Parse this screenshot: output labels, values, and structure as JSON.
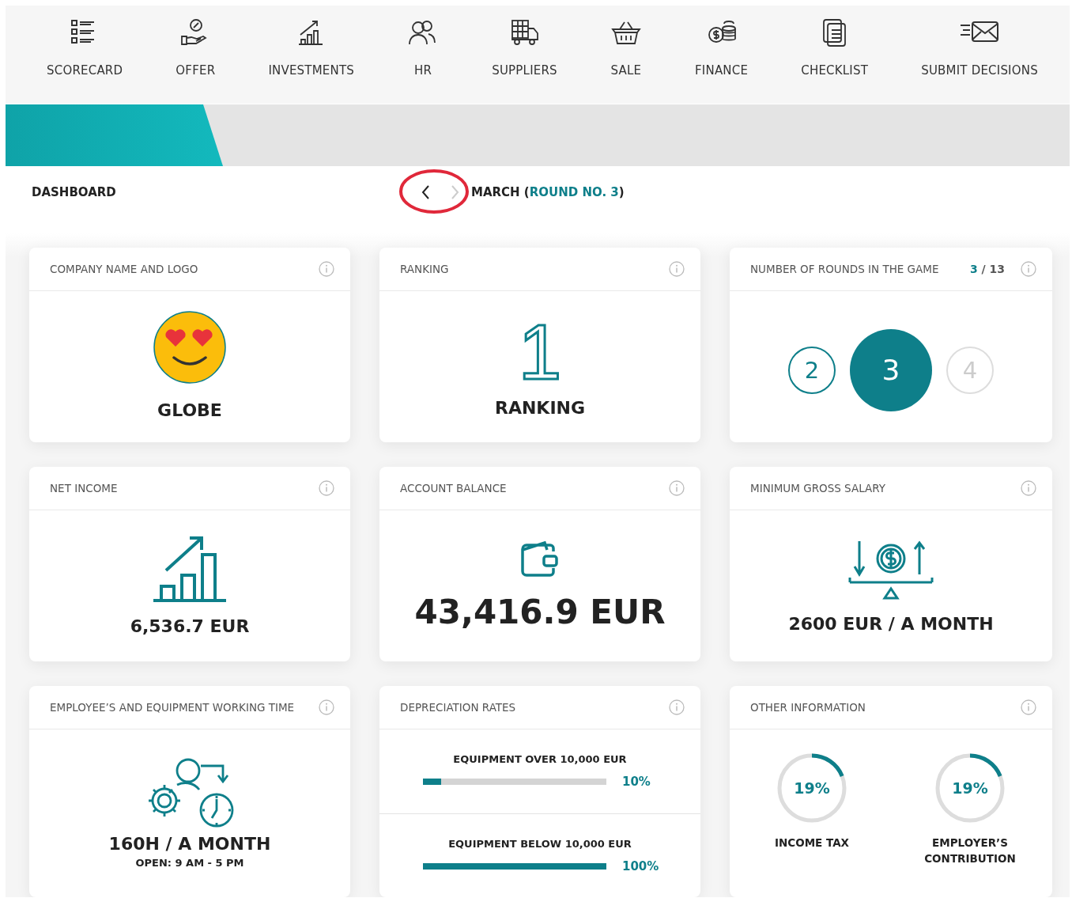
{
  "nav": [
    {
      "label": "SCORECARD"
    },
    {
      "label": "OFFER"
    },
    {
      "label": "INVESTMENTS"
    },
    {
      "label": "HR"
    },
    {
      "label": "SUPPLIERS"
    },
    {
      "label": "SALE"
    },
    {
      "label": "FINANCE"
    },
    {
      "label": "CHECKLIST"
    },
    {
      "label": "SUBMIT DECISIONS"
    }
  ],
  "header": {
    "title": "DASHBOARD",
    "period": "MARCH (*ROUND NO. 3*)",
    "prev_disabled": false,
    "next_disabled": true
  },
  "cards": [
    {
      "kind": "logo",
      "title": "COMPANY NAME AND LOGO",
      "value": "GLOBE"
    },
    {
      "kind": "ranking",
      "title": "RANKING",
      "rank": "1",
      "value": "RANKING"
    },
    {
      "kind": "rounds",
      "title": "NUMBER OF ROUNDS IN THE GAME",
      "counter": "**3** / 13",
      "rounds": [
        {
          "label": "2",
          "kind": "past"
        },
        {
          "label": "3",
          "kind": "current"
        },
        {
          "label": "4",
          "kind": "future"
        }
      ]
    },
    {
      "kind": "income",
      "title": "NET INCOME",
      "value": "6,536.7 EUR"
    },
    {
      "kind": "balance",
      "title": "ACCOUNT BALANCE",
      "value": "43,416.9 EUR"
    },
    {
      "kind": "salary",
      "title": "MINIMUM GROSS SALARY",
      "value": "2600 EUR / A MONTH"
    },
    {
      "kind": "worktime",
      "title": "EMPLOYEE’S AND EQUIPMENT WORKING TIME",
      "value": "160H / A MONTH",
      "note": "OPEN: 9 AM - 5 PM"
    },
    {
      "kind": "bars",
      "title": "DEPRECIATION RATES",
      "items": [
        {
          "label": "EQUIPMENT OVER 10,000 EUR",
          "level": 0.1,
          "reading": "10%"
        },
        {
          "label": "EQUIPMENT BELOW 10,000 EUR",
          "level": 1,
          "reading": "100%"
        }
      ]
    },
    {
      "kind": "donuts",
      "title": "OTHER INFORMATION",
      "items": [
        {
          "label": "INCOME TAX",
          "level": 0.19,
          "reading": "19%"
        },
        {
          "label": "EMPLOYER’S CONTRIBUTION",
          "level": 0.19,
          "reading": "19%"
        }
      ]
    }
  ]
}
